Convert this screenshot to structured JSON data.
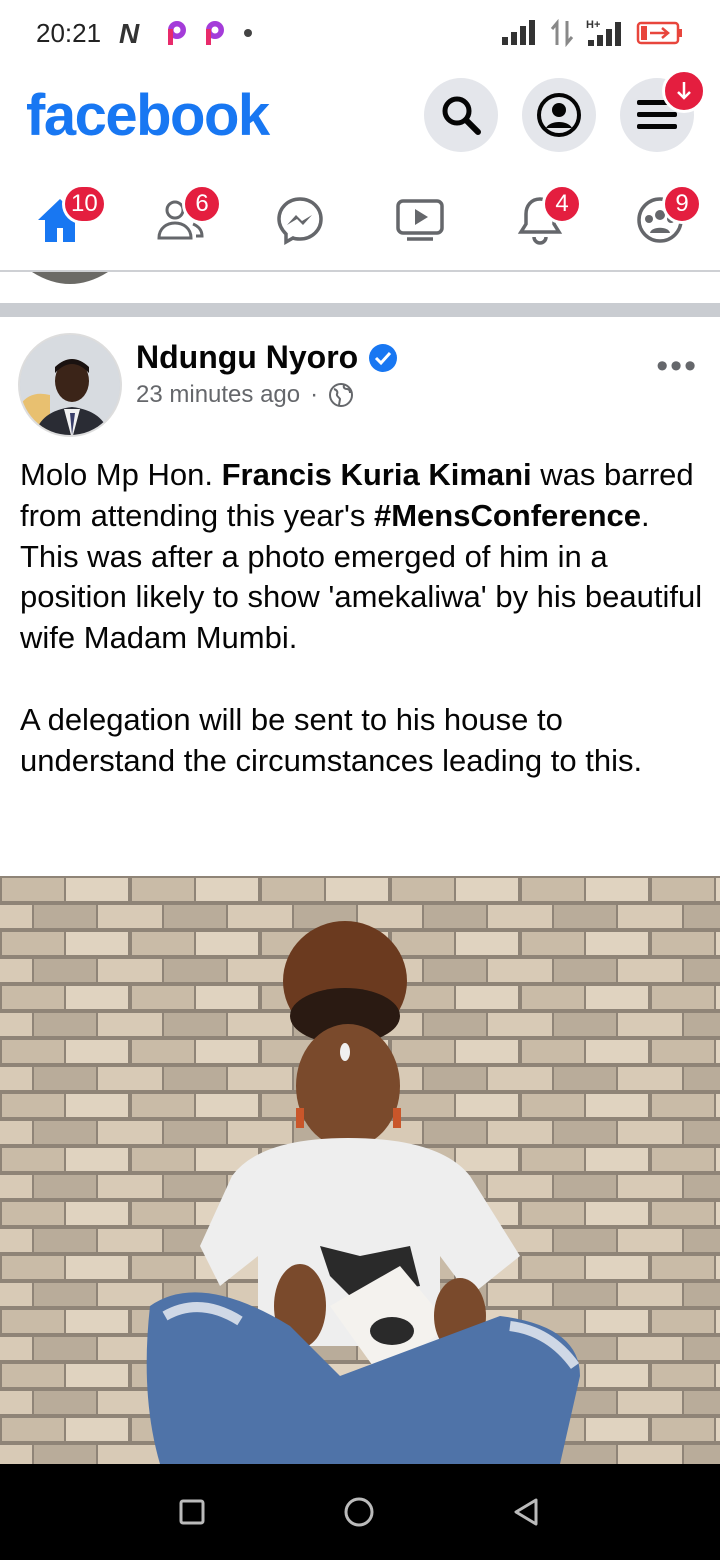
{
  "status_bar": {
    "time": "20:21",
    "app_icons": [
      "news-icon",
      "p-app-icon",
      "p-app-icon",
      "dot-icon"
    ],
    "right_icons": [
      "signal-icon",
      "data-transfer-icon",
      "hplus-signal-icon",
      "battery-charging-icon"
    ]
  },
  "app_bar": {
    "logo": "facebook",
    "search_icon": "search-icon",
    "profile_icon": "profile-icon",
    "menu_icon": "menu-icon",
    "menu_badge_icon": "download-arrow-icon"
  },
  "tabs": [
    {
      "name": "home",
      "icon": "home-icon",
      "badge": "10",
      "active": true
    },
    {
      "name": "friends",
      "icon": "friends-icon",
      "badge": "6",
      "active": false
    },
    {
      "name": "messenger",
      "icon": "messenger-icon",
      "badge": "",
      "active": false
    },
    {
      "name": "watch",
      "icon": "watch-icon",
      "badge": "",
      "active": false
    },
    {
      "name": "notifications",
      "icon": "bell-icon",
      "badge": "4",
      "active": false
    },
    {
      "name": "groups",
      "icon": "groups-icon",
      "badge": "9",
      "active": false
    }
  ],
  "post": {
    "author": "Ndungu Nyoro",
    "verified": true,
    "time": "23 minutes ago",
    "separator": "·",
    "audience_icon": "globe-icon",
    "more": "•••",
    "text_parts": {
      "p1a": "Molo Mp Hon. ",
      "p1b": "Francis Kuria Kimani",
      "p1c": " was barred from attending this year's ",
      "p1d": "#MensConference",
      "p1e": ". This was after a photo emerged of him in a position likely to show 'amekaliwa' by his beautiful wife Madam Mumbi.",
      "p2": "A delegation will be sent to his house to understand the circumstances leading to this."
    }
  },
  "colors": {
    "brand": "#1877f2",
    "badge": "#e41e3f",
    "secondary_text": "#65676b"
  },
  "nav_bar": {
    "icons": [
      "square-icon",
      "circle-icon",
      "back-triangle-icon"
    ]
  }
}
